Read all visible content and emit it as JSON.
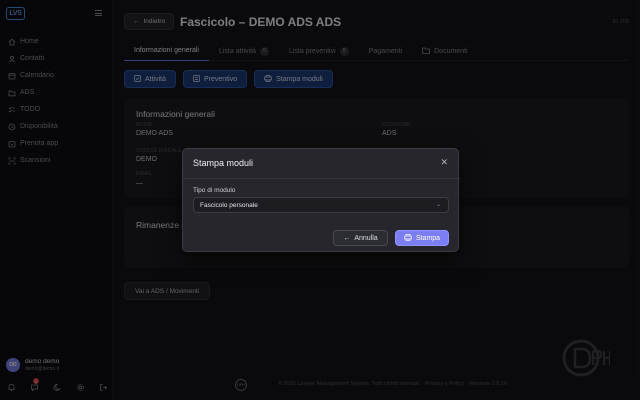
{
  "sidebar": {
    "logo": "LVS",
    "items": [
      {
        "label": "Home",
        "icon": "home-icon"
      },
      {
        "label": "Contatti",
        "icon": "contacts-icon"
      },
      {
        "label": "Calendario",
        "icon": "calendar-icon"
      },
      {
        "label": "ADS",
        "icon": "folder-icon"
      },
      {
        "label": "TODO",
        "icon": "checklist-icon"
      },
      {
        "label": "Disponibilità",
        "icon": "availability-icon"
      },
      {
        "label": "Prenota app",
        "icon": "booking-icon"
      },
      {
        "label": "Scansioni",
        "icon": "scan-icon"
      }
    ],
    "user": {
      "initials": "DD",
      "name": "demo demo",
      "email": "demo@demo.it"
    },
    "notification_count": "1"
  },
  "header": {
    "back_label": "Indietro",
    "title": "Fascicolo – DEMO ADS ADS",
    "id_text": "ID 200"
  },
  "tabs": [
    {
      "label": "Informazioni generali",
      "active": true
    },
    {
      "label": "Lista attività",
      "count": "0"
    },
    {
      "label": "Lista preventivi",
      "count": "0"
    },
    {
      "label": "Pagamenti"
    },
    {
      "label": "Documenti"
    }
  ],
  "actions": {
    "activity": "Attività",
    "estimate": "Preventivo",
    "print": "Stampa moduli"
  },
  "info_card": {
    "title": "Informazioni generali",
    "fields": [
      {
        "label": "NOME",
        "value": "DEMO ADS"
      },
      {
        "label": "COGNOME",
        "value": "ADS"
      },
      {
        "label": "CODICE FISCALE",
        "value": "DEMO"
      },
      {
        "label": "EMAIL",
        "value": "—"
      }
    ]
  },
  "remaining_card": {
    "title": "Rimanenze e"
  },
  "ads_button": "Vai a ADS / Movimenti",
  "footer": {
    "logo_text": "DPH",
    "text": "© 2025 Lawyer Management System. Tutti i diritti riservati.  ·  Privacy e Policy  ·  Versione 2.0.16"
  },
  "modal": {
    "title": "Stampa moduli",
    "field_label": "Tipo di modulo",
    "select_value": "Fascicolo personale",
    "cancel_label": "Annulla",
    "print_label": "Stampa"
  },
  "colors": {
    "accent": "#7c7ef4",
    "action_button": "#1d3a75",
    "background": "#151519"
  }
}
